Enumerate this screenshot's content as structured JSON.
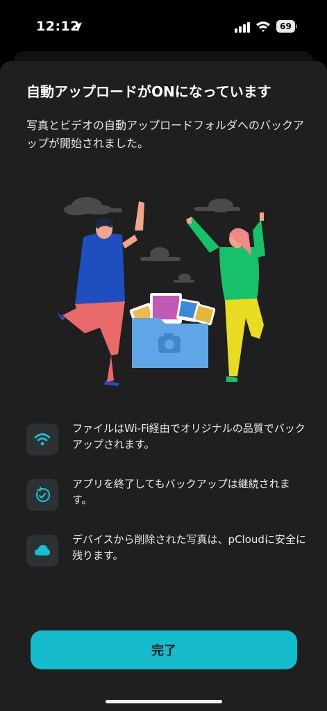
{
  "status_bar": {
    "time": "12:12",
    "battery": "69"
  },
  "dialog": {
    "title": "自動アップロードがONになっています",
    "subtitle": "写真とビデオの自動アップロードフォルダへのバックアップが開始されました。",
    "features": [
      {
        "icon": "wifi-icon",
        "text": "ファイルはWi-Fi経由でオリジナルの品質でバックアップされます。"
      },
      {
        "icon": "sync-icon",
        "text": "アプリを終了してもバックアップは継続されます。"
      },
      {
        "icon": "cloud-icon",
        "text": "デバイスから削除された写真は、pCloudに安全に残ります。"
      }
    ],
    "done_label": "完了"
  },
  "colors": {
    "accent": "#17bccc",
    "sheet_bg": "#1f1f1f",
    "icon_tile": "#2b3134"
  }
}
